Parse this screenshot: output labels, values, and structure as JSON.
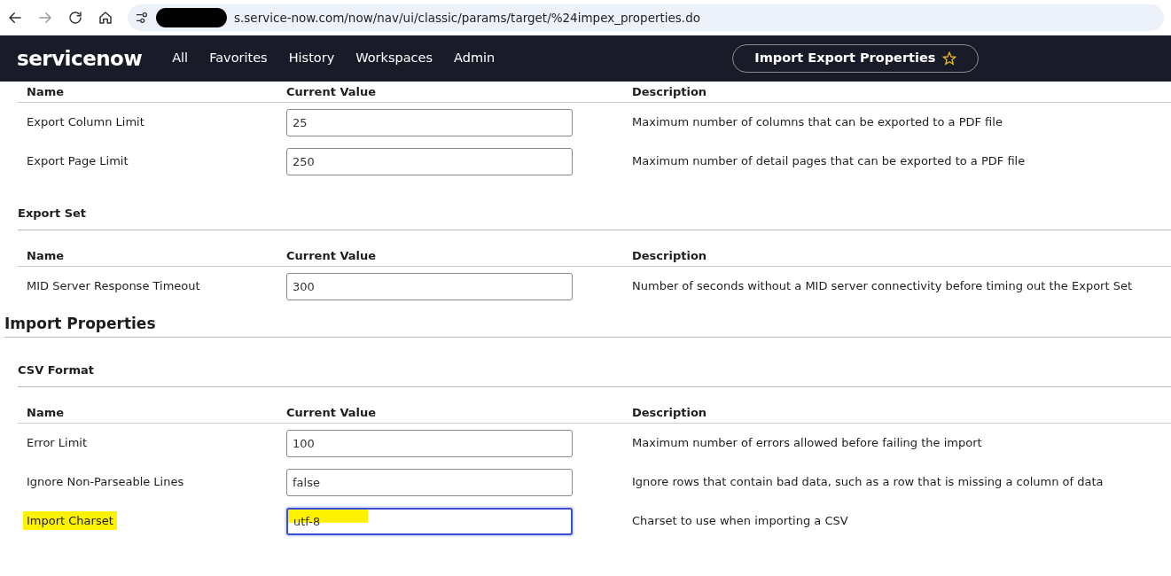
{
  "browser": {
    "url": "s.service-now.com/now/nav/ui/classic/params/target/%24impex_properties.do"
  },
  "navbar": {
    "logo": "servicenow",
    "menu": [
      "All",
      "Favorites",
      "History",
      "Workspaces",
      "Admin"
    ],
    "page_title": "Import Export Properties",
    "starred": false
  },
  "blocks": [
    {
      "kind": "table",
      "columns": [
        "Name",
        "Current Value",
        "Description"
      ],
      "rows": [
        {
          "name": "Export Column Limit",
          "value": "25",
          "description": "Maximum number of columns that can be exported to a PDF file",
          "highlighted": false,
          "focused": false
        },
        {
          "name": "Export Page Limit",
          "value": "250",
          "description": "Maximum number of detail pages that can be exported to a PDF file",
          "highlighted": false,
          "focused": false
        }
      ]
    },
    {
      "kind": "subheading",
      "text": "Export Set"
    },
    {
      "kind": "table",
      "columns": [
        "Name",
        "Current Value",
        "Description"
      ],
      "rows": [
        {
          "name": "MID Server Response Timeout",
          "value": "300",
          "description": "Number of seconds without a MID server connectivity before timing out the Export Set",
          "highlighted": false,
          "focused": false
        }
      ]
    },
    {
      "kind": "heading",
      "text": "Import Properties"
    },
    {
      "kind": "subheading",
      "text": "CSV Format"
    },
    {
      "kind": "table",
      "columns": [
        "Name",
        "Current Value",
        "Description"
      ],
      "rows": [
        {
          "name": "Error Limit",
          "value": "100",
          "description": "Maximum number of errors allowed before failing the import",
          "highlighted": false,
          "focused": false
        },
        {
          "name": "Ignore Non-Parseable Lines",
          "value": "false",
          "description": "Ignore rows that contain bad data, such as a row that is missing a column of data",
          "highlighted": false,
          "focused": false
        },
        {
          "name": "Import Charset",
          "value": "utf-8",
          "description": "Charset to use when importing a CSV",
          "highlighted": true,
          "focused": true
        }
      ]
    }
  ]
}
